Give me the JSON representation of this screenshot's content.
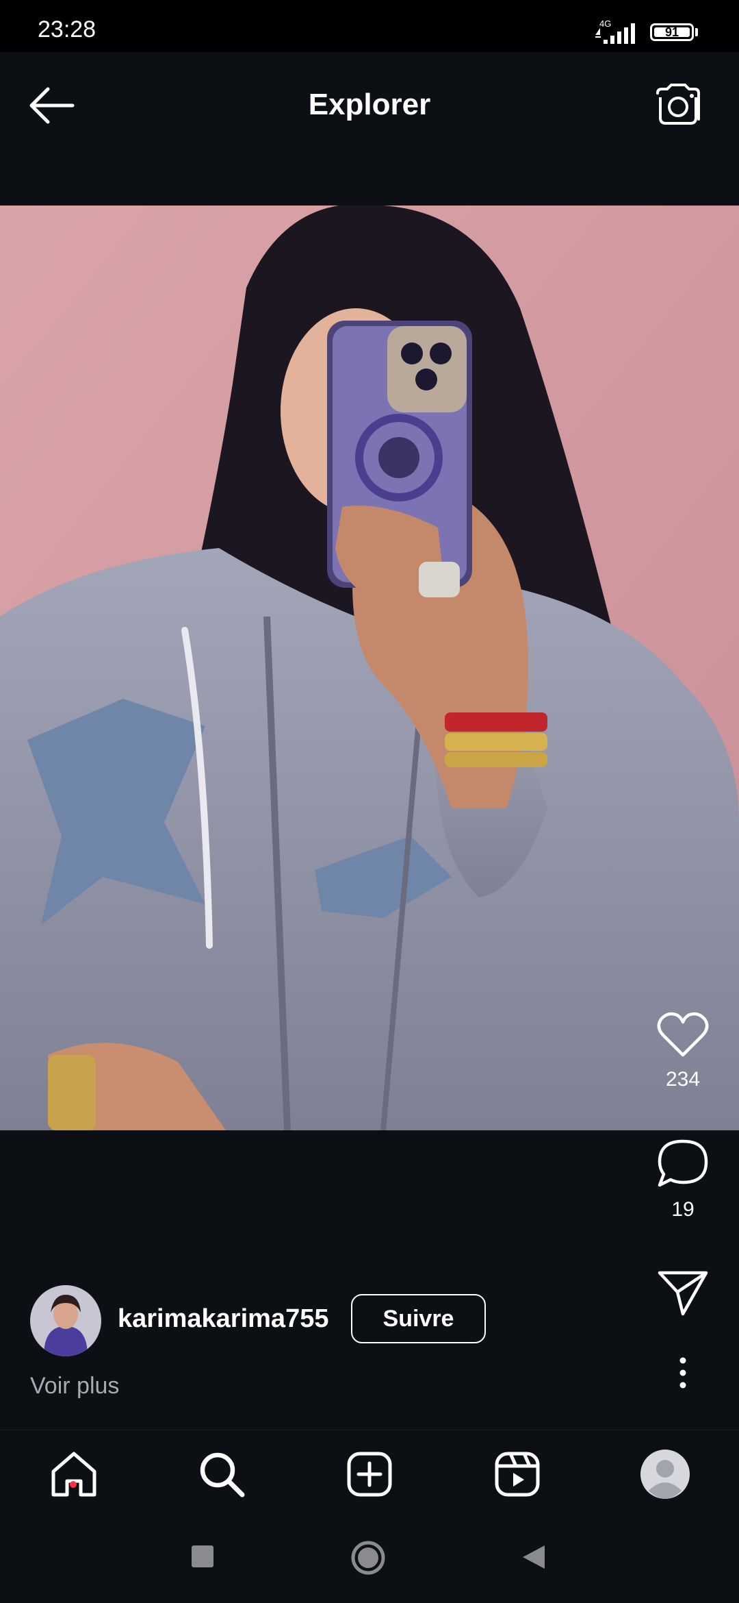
{
  "status_bar": {
    "time": "23:28",
    "network": "4G",
    "battery_level": "91"
  },
  "header": {
    "title": "Explorer",
    "back_icon": "arrow-left-icon",
    "camera_icon": "camera-icon"
  },
  "post": {
    "photo_description_icon": "photo",
    "like_count": "234",
    "comment_count": "19",
    "author": {
      "username": "karimakarima755",
      "follow_label": "Suivre"
    },
    "see_more_label": "Voir plus"
  },
  "bottom_nav": {
    "items": [
      "home-icon",
      "search-icon",
      "create-icon",
      "reels-icon",
      "profile-icon"
    ],
    "home_notification": true
  },
  "colors": {
    "background": "#0c0f14",
    "status_bar": "#000000",
    "notification_dot": "#ff3040",
    "secondary_text": "#a8aab0"
  }
}
